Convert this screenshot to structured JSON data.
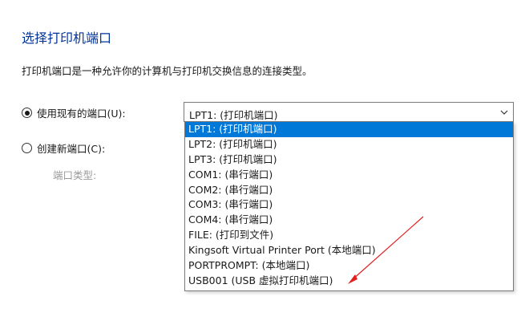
{
  "title": "选择打印机端口",
  "description": "打印机端口是一种允许你的计算机与打印机交换信息的连接类型。",
  "options": {
    "use_existing_label": "使用现有的端口(U):",
    "create_new_label": "创建新端口(C):",
    "port_type_label": "端口类型:"
  },
  "combo": {
    "selected_value": "LPT1: (打印机端口)"
  },
  "port_list": [
    "LPT1: (打印机端口)",
    "LPT2: (打印机端口)",
    "LPT3: (打印机端口)",
    "COM1: (串行端口)",
    "COM2: (串行端口)",
    "COM3: (串行端口)",
    "COM4: (串行端口)",
    "FILE: (打印到文件)",
    "Kingsoft Virtual Printer Port (本地端口)",
    "PORTPROMPT: (本地端口)",
    "USB001 (USB 虚拟打印机端口)"
  ],
  "colors": {
    "title": "#003399",
    "selection": "#0078d7",
    "annotation_arrow": "#e02020"
  },
  "icons": {
    "chevron": "chevron-down-icon",
    "arrow": "red-annotation-arrow"
  }
}
